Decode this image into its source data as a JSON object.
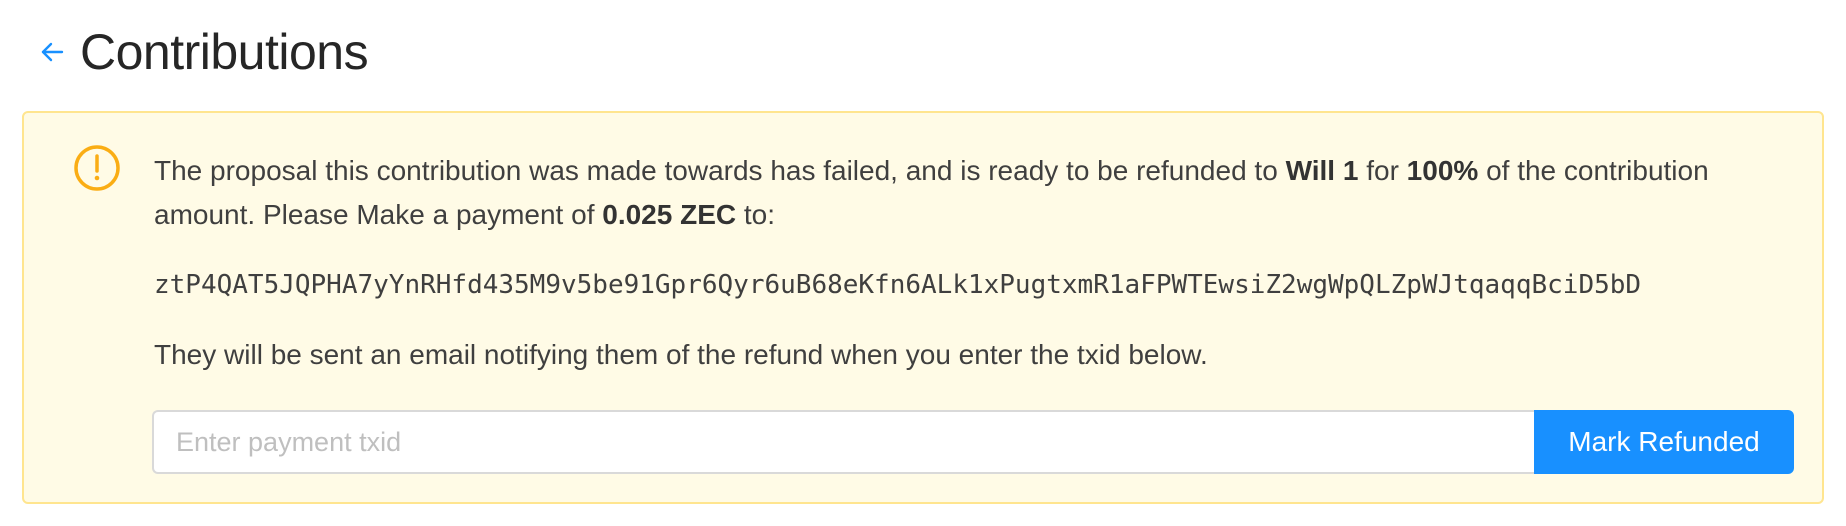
{
  "header": {
    "back_icon": "arrow-left-icon",
    "title": "Contributions"
  },
  "alert": {
    "icon": "exclamation-circle-icon",
    "message": {
      "part1": "The proposal this contribution was made towards has failed, and is ready to be refunded to ",
      "recipient": "Will 1",
      "part2": " for ",
      "percent": "100%",
      "part3": " of the contribution amount. Please Make a payment of ",
      "amount": "0.025 ZEC",
      "part4": " to:"
    },
    "address": "ztP4QAT5JQPHA7yYnRHfd435M9v5be91Gpr6Qyr6uB68eKfn6ALk1xPugtxmR1aFPWTEwsiZ2wgWpQLZpWJtqaqqBciD5bD",
    "note": "They will be sent an email notifying them of the refund when you enter the txid below."
  },
  "form": {
    "txid_placeholder": "Enter payment txid",
    "txid_value": "",
    "submit_label": "Mark Refunded"
  },
  "colors": {
    "accent": "#1890ff",
    "warning": "#faad14",
    "alert_bg": "#fffbe6",
    "alert_border": "#ffe58f"
  }
}
